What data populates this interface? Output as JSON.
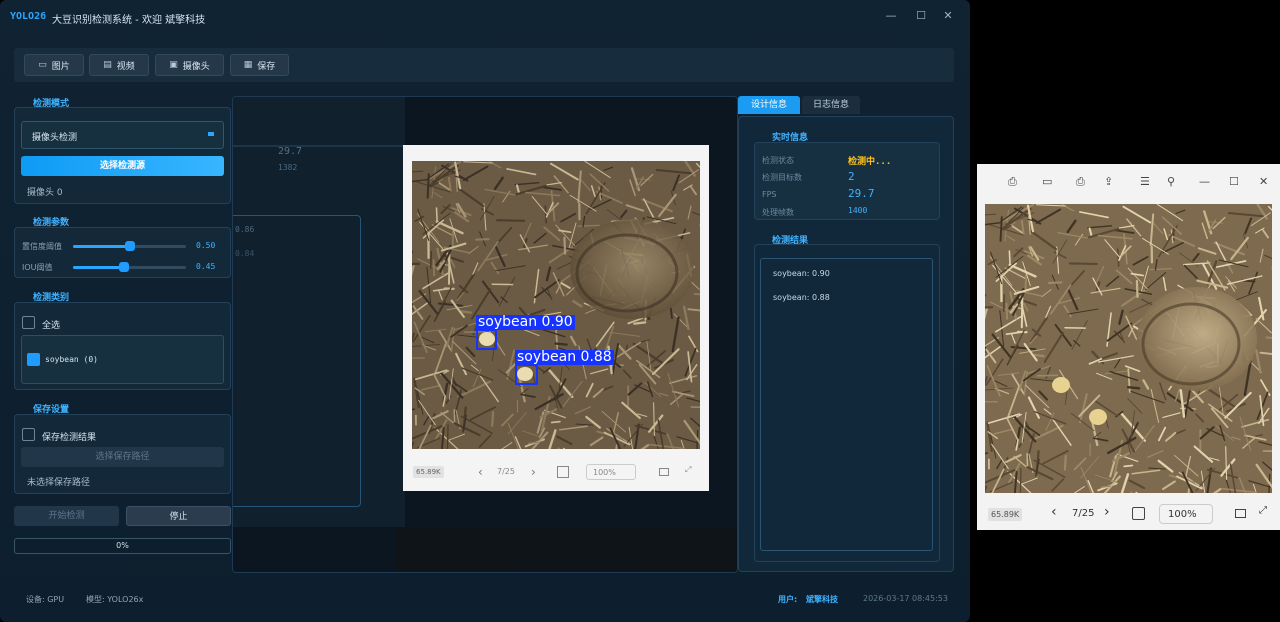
{
  "window": {
    "logo": "YOLO26",
    "title": "大豆识别检测系统 - 欢迎 斌擎科技",
    "controls": [
      "—",
      "☐",
      "✕"
    ]
  },
  "toolbar": {
    "image_label": "图片",
    "video_label": "视频",
    "camera_label": "摄像头",
    "save_label": "保存"
  },
  "mode": {
    "title": "检测模式",
    "selected": "摄像头检测",
    "select_source_label": "选择检测源",
    "source_text": "摄像头 0"
  },
  "params": {
    "title": "检测参数",
    "conf_label": "置信度阈值",
    "conf_value": "0.50",
    "conf_fraction": 0.5,
    "iou_label": "IOU阈值",
    "iou_value": "0.45",
    "iou_fraction": 0.45
  },
  "classes": {
    "title": "检测类别",
    "select_all_label": "全选",
    "items": [
      {
        "label": "soybean (0)",
        "checked": true
      }
    ]
  },
  "save": {
    "title": "保存设置",
    "save_results_label": "保存检测结果",
    "choose_path_label": "选择保存路径",
    "path_status": "未选择保存路径"
  },
  "controls": {
    "start_label": "开始检测",
    "stop_label": "停止",
    "progress_text": "0%"
  },
  "video": {
    "ghost_value_1": "29.7",
    "ghost_value_2": "1382",
    "ghost_value_3": "0.86",
    "ghost_value_4": "0.84",
    "viewer_size_chip": "65.89K",
    "viewer_page": "7/25",
    "viewer_zoom": "100%",
    "detections": [
      {
        "label": "soybean 0.90"
      },
      {
        "label": "soybean 0.88"
      }
    ]
  },
  "tabs": {
    "design_label": "设计信息",
    "log_label": "日志信息"
  },
  "realtime": {
    "title": "实时信息",
    "rows": [
      {
        "key": "检测状态",
        "value": "检测中..."
      },
      {
        "key": "检测目标数",
        "value": "2"
      },
      {
        "key": "FPS",
        "value": "29.7"
      },
      {
        "key": "处理帧数",
        "value": "1400"
      }
    ]
  },
  "results": {
    "title": "检测结果",
    "items": [
      "soybean: 0.90",
      "soybean: 0.88"
    ]
  },
  "statusbar": {
    "device": "设备: GPU",
    "model": "模型: YOLO26x",
    "user_label": "用户:",
    "user_name": "斌擎科技",
    "datetime": "2026-03-17 08:45:53"
  },
  "viewer": {
    "size_chip": "65.89K",
    "page": "7/25",
    "zoom": "100%"
  },
  "colors": {
    "accent": "#2aa6ff",
    "status_running": "#ffc21a",
    "detection_box": "#1633ff"
  }
}
